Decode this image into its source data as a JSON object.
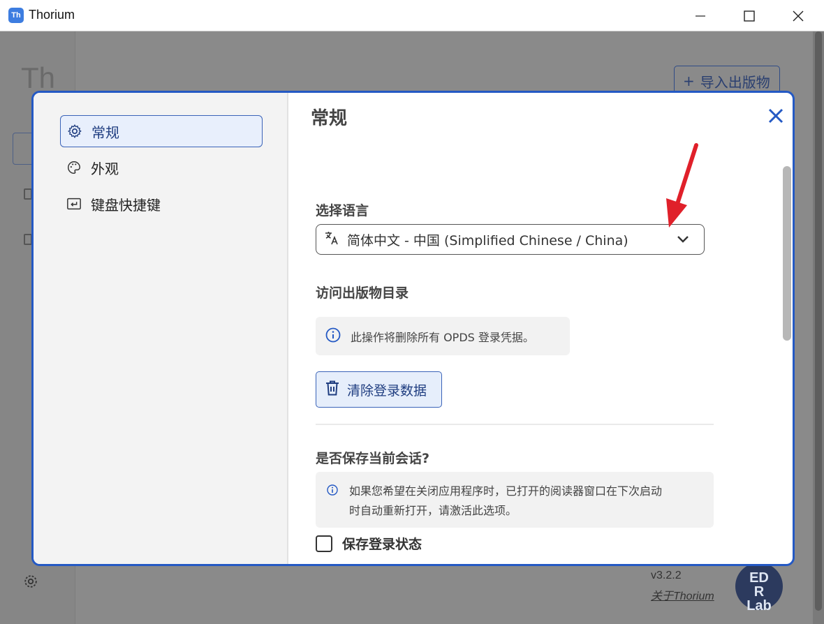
{
  "window": {
    "app_icon_text": "Th",
    "title": "Thorium"
  },
  "background": {
    "logo": "Th",
    "import_button": "导入出版物",
    "version": "v3.2.2",
    "about_link": "关于Thorium",
    "edrlab_logo": "EDRLab"
  },
  "dialog": {
    "nav": [
      {
        "label": "常规",
        "icon": "gear-icon",
        "active": true
      },
      {
        "label": "外观",
        "icon": "palette-icon",
        "active": false
      },
      {
        "label": "键盘快捷键",
        "icon": "keyboard-return-icon",
        "active": false
      }
    ],
    "title": "常规",
    "language": {
      "label": "选择语言",
      "selected": "简体中文 - 中国 (Simplified Chinese / China)"
    },
    "catalog": {
      "label": "访问出版物目录",
      "info": "此操作将删除所有 OPDS 登录凭据。",
      "clear_button": "清除登录数据"
    },
    "session": {
      "label": "是否保存当前会话?",
      "info_line1": "如果您希望在关闭应用程序时，已打开的阅读器窗口在下次启动",
      "info_line2": "时自动重新打开，请激活此选项。",
      "checkbox_label": "保存登录状态",
      "checked": false
    }
  },
  "colors": {
    "accent": "#2459c4",
    "annotation_arrow": "#e0202a"
  }
}
